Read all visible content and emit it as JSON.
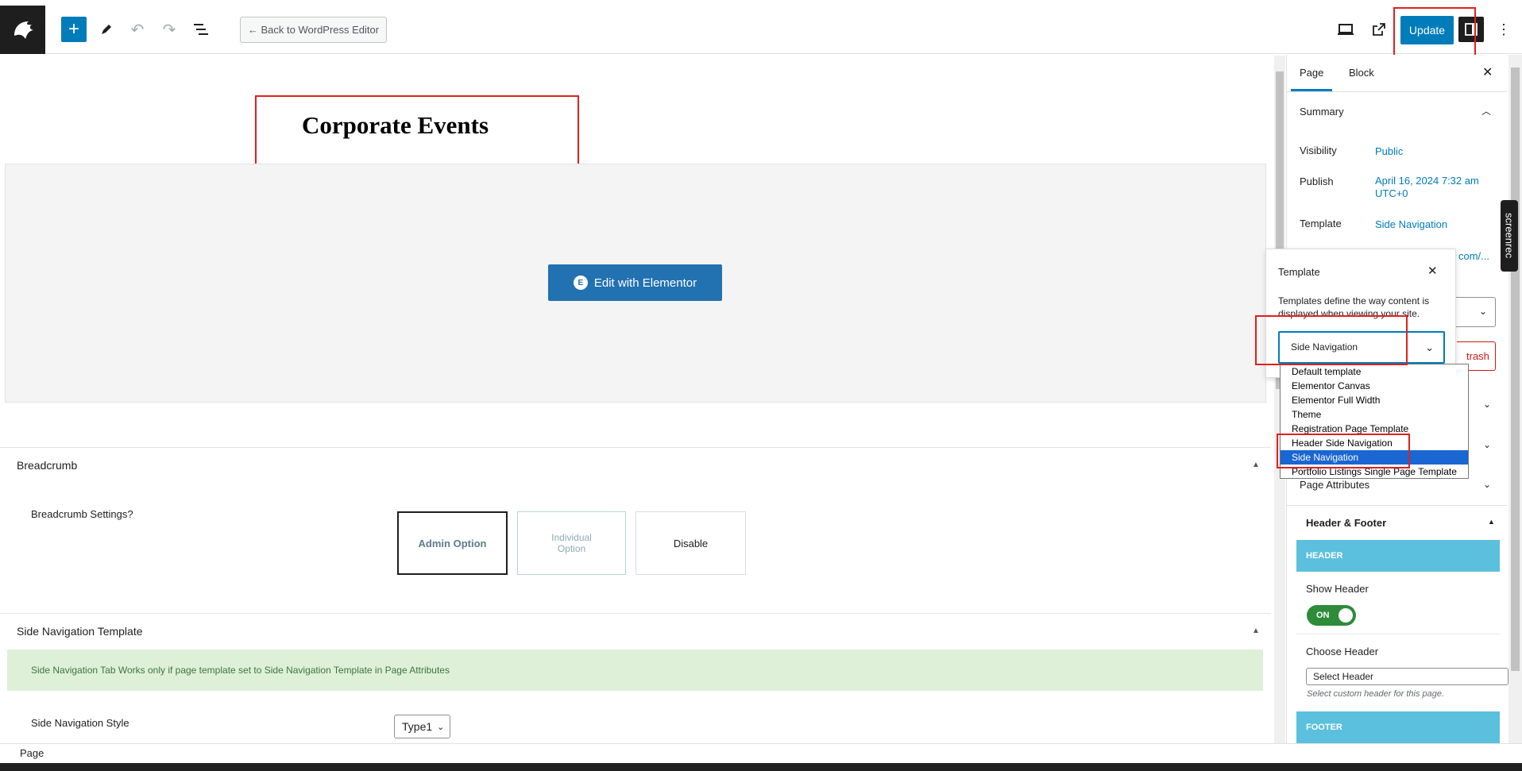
{
  "toolbar": {
    "back_label": "← Back to WordPress Editor",
    "update_label": "Update"
  },
  "canvas": {
    "page_title": "Corporate Events",
    "edit_elementor_label": "Edit with Elementor",
    "edit_elementor_badge": "E"
  },
  "breadcrumb": {
    "heading": "Breadcrumb",
    "settings_label": "Breadcrumb Settings?",
    "options": [
      "Admin Option",
      "Individual Option",
      "Disable"
    ]
  },
  "side_nav": {
    "heading": "Side Navigation Template",
    "notice": "Side Navigation Tab Works only if page template set to Side Navigation Template in Page Attributes",
    "style_label": "Side Navigation Style",
    "style_value": "Type1"
  },
  "sidebar": {
    "tabs": [
      "Page",
      "Block"
    ],
    "summary_heading": "Summary",
    "visibility_label": "Visibility",
    "visibility_value": "Public",
    "publish_label": "Publish",
    "publish_value_line1": "April 16, 2024 7:32 am",
    "publish_value_line2": "UTC+0",
    "template_label": "Template",
    "template_value": "Side Navigation",
    "url_partial": "com/...",
    "trash_partial": "trash",
    "page_attributes": "Page Attributes",
    "hf_heading": "Header & Footer",
    "header_bar": "HEADER",
    "show_header_label": "Show Header",
    "toggle_label": "ON",
    "choose_header_label": "Choose Header",
    "select_header_value": "Select Header",
    "select_header_help": "Select custom header for this page.",
    "footer_bar": "FOOTER",
    "screenrec": "screenrec"
  },
  "template_popover": {
    "title": "Template",
    "description": "Templates define the way content is displayed when viewing your site.",
    "selected": "Side Navigation",
    "options": [
      "Default template",
      "Elementor Canvas",
      "Elementor Full Width",
      "Theme",
      "Registration Page Template",
      "Header Side Navigation",
      "Side Navigation",
      "Portfolio Listings Single Page Template"
    ],
    "selected_index": 6
  },
  "statusbar": {
    "label": "Page"
  },
  "colors": {
    "primary": "#007cba",
    "annotation": "#e0201e",
    "notice_bg": "#dff0d8",
    "hf_bar": "#5bc0de",
    "toggle_on": "#2e8b3a"
  }
}
